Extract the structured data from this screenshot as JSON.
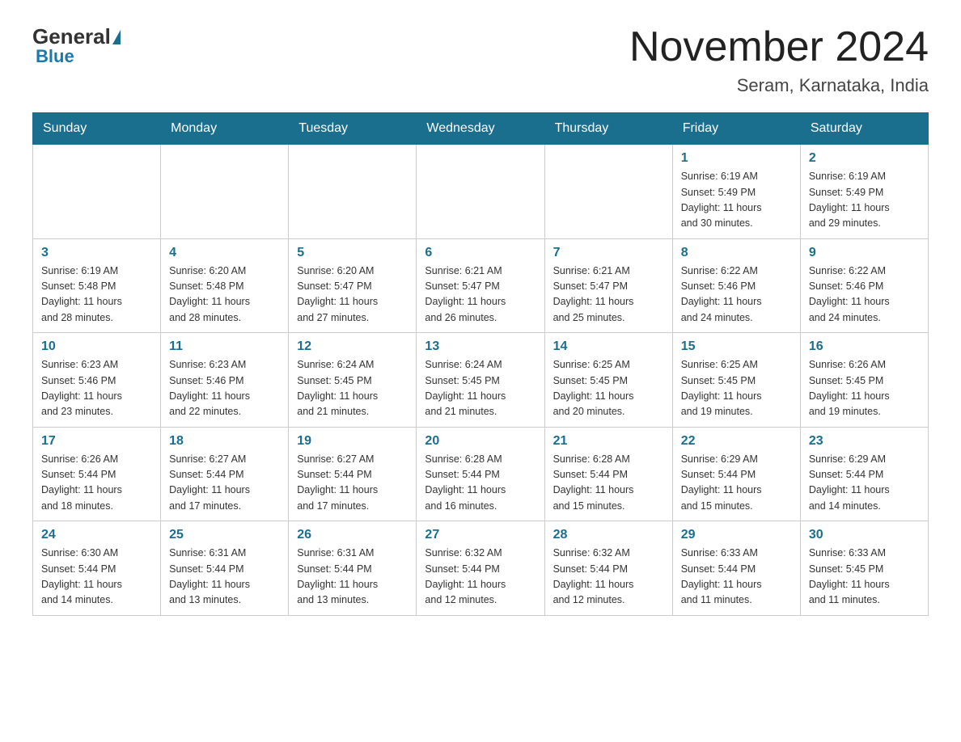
{
  "logo": {
    "general": "General",
    "blue": "Blue"
  },
  "header": {
    "month_year": "November 2024",
    "location": "Seram, Karnataka, India"
  },
  "days_of_week": [
    "Sunday",
    "Monday",
    "Tuesday",
    "Wednesday",
    "Thursday",
    "Friday",
    "Saturday"
  ],
  "weeks": [
    [
      {
        "day": "",
        "info": ""
      },
      {
        "day": "",
        "info": ""
      },
      {
        "day": "",
        "info": ""
      },
      {
        "day": "",
        "info": ""
      },
      {
        "day": "",
        "info": ""
      },
      {
        "day": "1",
        "info": "Sunrise: 6:19 AM\nSunset: 5:49 PM\nDaylight: 11 hours\nand 30 minutes."
      },
      {
        "day": "2",
        "info": "Sunrise: 6:19 AM\nSunset: 5:49 PM\nDaylight: 11 hours\nand 29 minutes."
      }
    ],
    [
      {
        "day": "3",
        "info": "Sunrise: 6:19 AM\nSunset: 5:48 PM\nDaylight: 11 hours\nand 28 minutes."
      },
      {
        "day": "4",
        "info": "Sunrise: 6:20 AM\nSunset: 5:48 PM\nDaylight: 11 hours\nand 28 minutes."
      },
      {
        "day": "5",
        "info": "Sunrise: 6:20 AM\nSunset: 5:47 PM\nDaylight: 11 hours\nand 27 minutes."
      },
      {
        "day": "6",
        "info": "Sunrise: 6:21 AM\nSunset: 5:47 PM\nDaylight: 11 hours\nand 26 minutes."
      },
      {
        "day": "7",
        "info": "Sunrise: 6:21 AM\nSunset: 5:47 PM\nDaylight: 11 hours\nand 25 minutes."
      },
      {
        "day": "8",
        "info": "Sunrise: 6:22 AM\nSunset: 5:46 PM\nDaylight: 11 hours\nand 24 minutes."
      },
      {
        "day": "9",
        "info": "Sunrise: 6:22 AM\nSunset: 5:46 PM\nDaylight: 11 hours\nand 24 minutes."
      }
    ],
    [
      {
        "day": "10",
        "info": "Sunrise: 6:23 AM\nSunset: 5:46 PM\nDaylight: 11 hours\nand 23 minutes."
      },
      {
        "day": "11",
        "info": "Sunrise: 6:23 AM\nSunset: 5:46 PM\nDaylight: 11 hours\nand 22 minutes."
      },
      {
        "day": "12",
        "info": "Sunrise: 6:24 AM\nSunset: 5:45 PM\nDaylight: 11 hours\nand 21 minutes."
      },
      {
        "day": "13",
        "info": "Sunrise: 6:24 AM\nSunset: 5:45 PM\nDaylight: 11 hours\nand 21 minutes."
      },
      {
        "day": "14",
        "info": "Sunrise: 6:25 AM\nSunset: 5:45 PM\nDaylight: 11 hours\nand 20 minutes."
      },
      {
        "day": "15",
        "info": "Sunrise: 6:25 AM\nSunset: 5:45 PM\nDaylight: 11 hours\nand 19 minutes."
      },
      {
        "day": "16",
        "info": "Sunrise: 6:26 AM\nSunset: 5:45 PM\nDaylight: 11 hours\nand 19 minutes."
      }
    ],
    [
      {
        "day": "17",
        "info": "Sunrise: 6:26 AM\nSunset: 5:44 PM\nDaylight: 11 hours\nand 18 minutes."
      },
      {
        "day": "18",
        "info": "Sunrise: 6:27 AM\nSunset: 5:44 PM\nDaylight: 11 hours\nand 17 minutes."
      },
      {
        "day": "19",
        "info": "Sunrise: 6:27 AM\nSunset: 5:44 PM\nDaylight: 11 hours\nand 17 minutes."
      },
      {
        "day": "20",
        "info": "Sunrise: 6:28 AM\nSunset: 5:44 PM\nDaylight: 11 hours\nand 16 minutes."
      },
      {
        "day": "21",
        "info": "Sunrise: 6:28 AM\nSunset: 5:44 PM\nDaylight: 11 hours\nand 15 minutes."
      },
      {
        "day": "22",
        "info": "Sunrise: 6:29 AM\nSunset: 5:44 PM\nDaylight: 11 hours\nand 15 minutes."
      },
      {
        "day": "23",
        "info": "Sunrise: 6:29 AM\nSunset: 5:44 PM\nDaylight: 11 hours\nand 14 minutes."
      }
    ],
    [
      {
        "day": "24",
        "info": "Sunrise: 6:30 AM\nSunset: 5:44 PM\nDaylight: 11 hours\nand 14 minutes."
      },
      {
        "day": "25",
        "info": "Sunrise: 6:31 AM\nSunset: 5:44 PM\nDaylight: 11 hours\nand 13 minutes."
      },
      {
        "day": "26",
        "info": "Sunrise: 6:31 AM\nSunset: 5:44 PM\nDaylight: 11 hours\nand 13 minutes."
      },
      {
        "day": "27",
        "info": "Sunrise: 6:32 AM\nSunset: 5:44 PM\nDaylight: 11 hours\nand 12 minutes."
      },
      {
        "day": "28",
        "info": "Sunrise: 6:32 AM\nSunset: 5:44 PM\nDaylight: 11 hours\nand 12 minutes."
      },
      {
        "day": "29",
        "info": "Sunrise: 6:33 AM\nSunset: 5:44 PM\nDaylight: 11 hours\nand 11 minutes."
      },
      {
        "day": "30",
        "info": "Sunrise: 6:33 AM\nSunset: 5:45 PM\nDaylight: 11 hours\nand 11 minutes."
      }
    ]
  ]
}
